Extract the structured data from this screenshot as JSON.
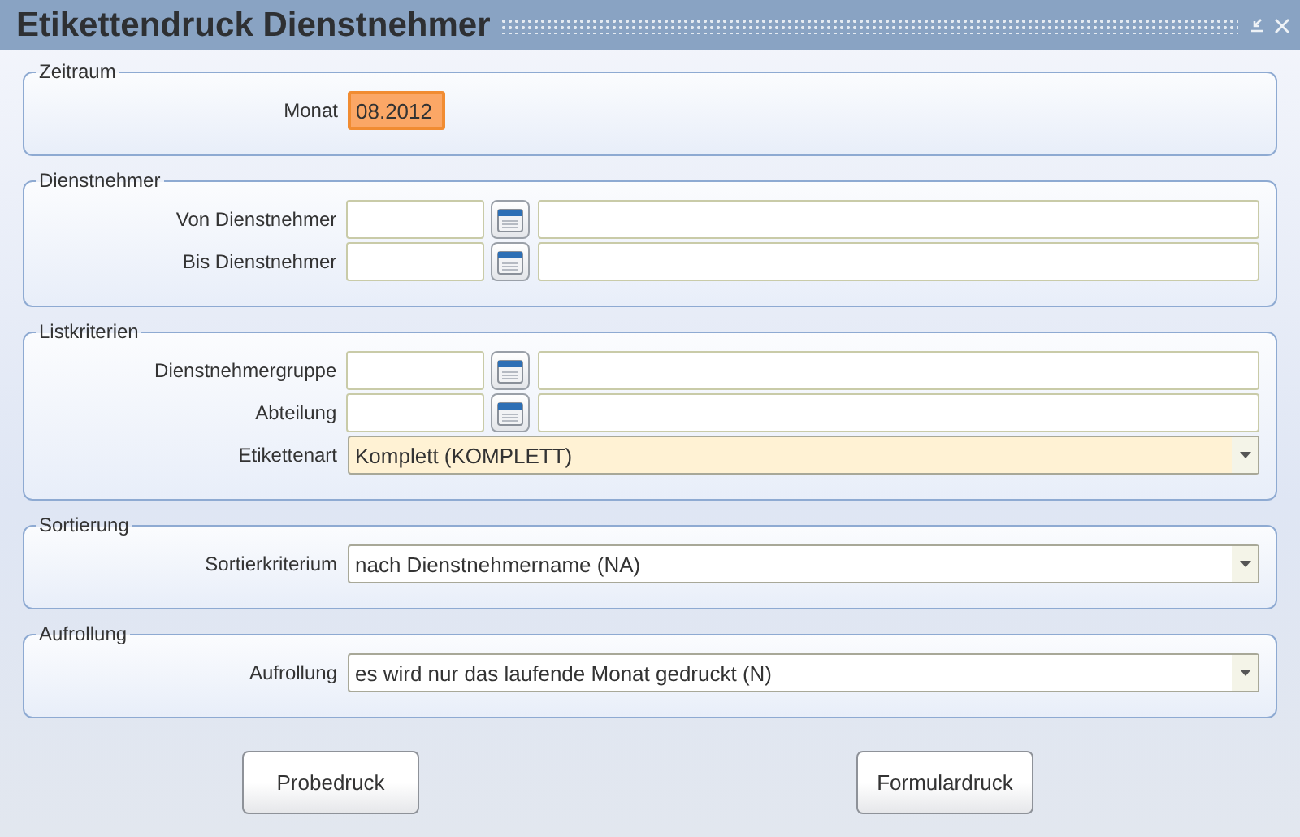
{
  "window": {
    "title": "Etikettendruck Dienstnehmer"
  },
  "sections": [
    {
      "legend": "Zeitraum",
      "rows": [
        {
          "kind": "month",
          "label": "Monat",
          "value": "08.2012",
          "focused": true
        }
      ]
    },
    {
      "legend": "Dienstnehmer",
      "rows": [
        {
          "kind": "range",
          "label": "Von Dienstnehmer"
        },
        {
          "kind": "range",
          "label": "Bis Dienstnehmer"
        }
      ]
    },
    {
      "legend": "Listkriterien",
      "rows": [
        {
          "kind": "range",
          "label": "Dienstnehmergruppe"
        },
        {
          "kind": "range",
          "label": "Abteilung"
        },
        {
          "kind": "select",
          "label": "Etikettenart",
          "value": "Komplett (KOMPLETT)",
          "highlighted": true
        }
      ]
    },
    {
      "legend": "Sortierung",
      "rows": [
        {
          "kind": "select",
          "label": "Sortierkriterium",
          "value": "nach Dienstnehmername (NA)",
          "highlighted": false
        }
      ]
    },
    {
      "legend": "Aufrollung",
      "rows": [
        {
          "kind": "select",
          "label": "Aufrollung",
          "value": "es wird nur das laufende Monat gedruckt (N)",
          "highlighted": false
        }
      ]
    }
  ],
  "buttons": [
    "Probedruck",
    "Formulardruck"
  ]
}
